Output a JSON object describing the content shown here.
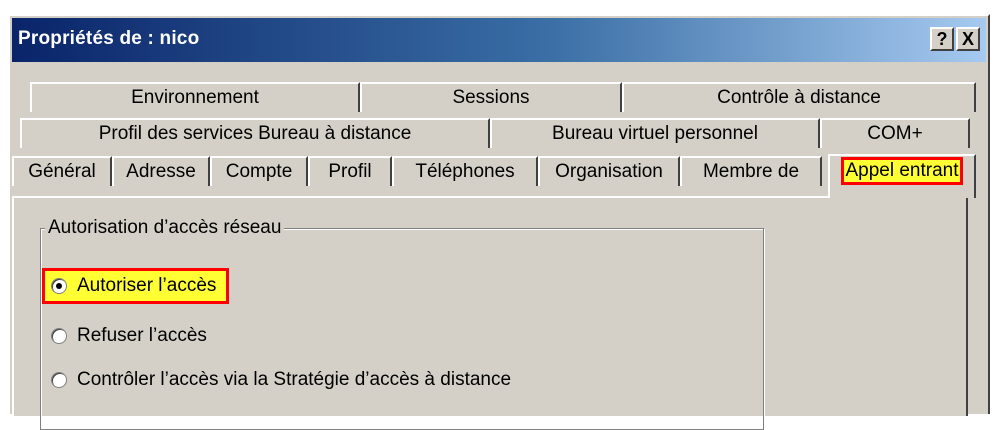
{
  "window": {
    "title": "Propriétés de : nico",
    "help_button": "?",
    "close_button": "X"
  },
  "tabs": {
    "row1": [
      "Environnement",
      "Sessions",
      "Contrôle à distance"
    ],
    "row2": [
      "Profil des services Bureau à distance",
      "Bureau virtuel personnel",
      "COM+"
    ],
    "row3": [
      "Général",
      "Adresse",
      "Compte",
      "Profil",
      "Téléphones",
      "Organisation",
      "Membre de",
      "Appel entrant"
    ],
    "active": "Appel entrant"
  },
  "network_access": {
    "legend": "Autorisation d’accès réseau",
    "options": [
      {
        "label": "Autoriser l’accès",
        "checked": true
      },
      {
        "label": "Refuser l’accès",
        "checked": false
      },
      {
        "label": "Contrôler l’accès via la Stratégie d’accès à distance",
        "checked": false
      }
    ]
  },
  "colors": {
    "highlight": "#ffff33",
    "highlight_border": "#ff0000",
    "title_gradient_start": "#0a246a",
    "dialog_face": "#d4d0c8"
  }
}
